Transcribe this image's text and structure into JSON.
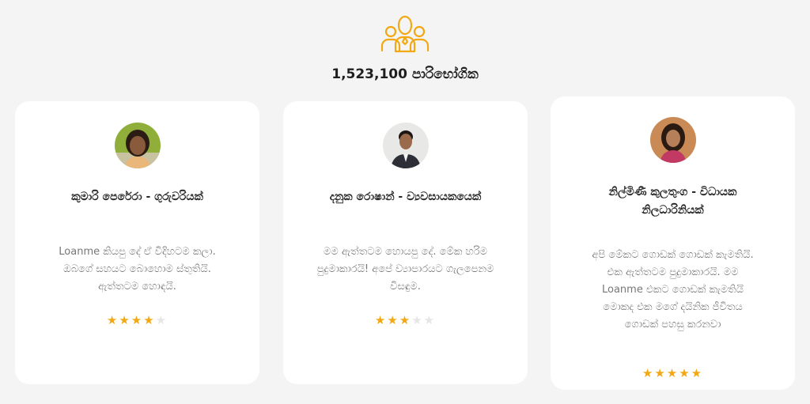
{
  "header": {
    "icon": "users-group-icon",
    "users_count": "1,523,100 පාරිභෝගික"
  },
  "colors": {
    "accent": "#f2a812",
    "background": "#f4f4f4",
    "card": "#ffffff"
  },
  "testimonials": [
    {
      "name": "කුමාරි පෙරේරා - ගුරුවරියක්",
      "quote": "Loanme කියපු දේ ඒ විදිහටම කලා. ඔබගේ සහයට බොහොම ස්තුතියි. ඇත්තටම හොඳයි.",
      "rating": 4,
      "rating_max": 5
    },
    {
      "name": "දනුක රොෂාන් - ව්‍යවසායකයෙක්",
      "quote": "මම ඇත්තටම හොයපු දේ. මේක හරිම පුදුමාකාරයි! අපේ ව්‍යාපාරයට ගැලපෙනම විසඳුම.",
      "rating": 3,
      "rating_max": 5
    },
    {
      "name": "නිල්මිණී කුලතුංග - විධායක නිලධාරිනියක්",
      "quote": "අපි මේකට ගොඩක් ගොඩක් කැමතියි. එක ඇත්තටම පුදුමාකාරයි. මම Loanme එකට ගොඩක් කැමතියි මොකද එක මගේ දයිනික ජීවිතය ගොඩක් පහසු කරනවා",
      "rating": 5,
      "rating_max": 5
    }
  ]
}
